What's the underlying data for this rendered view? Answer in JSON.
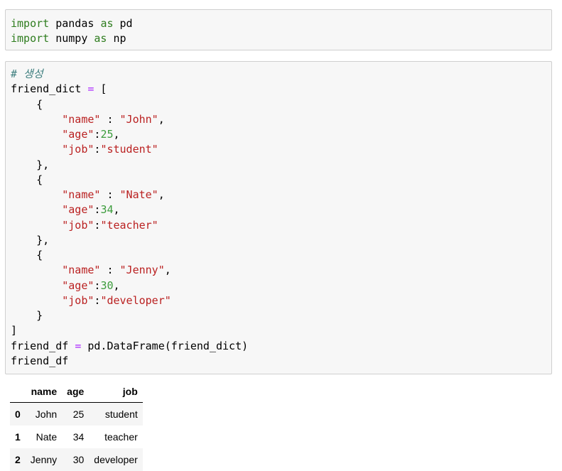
{
  "cells": [
    {
      "lines": [
        [
          [
            "kw",
            "import"
          ],
          [
            "t",
            " pandas "
          ],
          [
            "kw",
            "as"
          ],
          [
            "t",
            " pd"
          ]
        ],
        [
          [
            "kw",
            "import"
          ],
          [
            "t",
            " numpy "
          ],
          [
            "kw",
            "as"
          ],
          [
            "t",
            " np"
          ]
        ]
      ]
    },
    {
      "lines": [
        [
          [
            "cmt",
            "# 생성"
          ]
        ],
        [
          [
            "t",
            "friend_dict "
          ],
          [
            "op",
            "="
          ],
          [
            "t",
            " ["
          ]
        ],
        [
          [
            "t",
            "    {"
          ]
        ],
        [
          [
            "t",
            "        "
          ],
          [
            "str",
            "\"name\""
          ],
          [
            "t",
            " : "
          ],
          [
            "str",
            "\"John\""
          ],
          [
            "t",
            ","
          ]
        ],
        [
          [
            "t",
            "        "
          ],
          [
            "str",
            "\"age\""
          ],
          [
            "t",
            ":"
          ],
          [
            "num",
            "25"
          ],
          [
            "t",
            ","
          ]
        ],
        [
          [
            "t",
            "        "
          ],
          [
            "str",
            "\"job\""
          ],
          [
            "t",
            ":"
          ],
          [
            "str",
            "\"student\""
          ]
        ],
        [
          [
            "t",
            "    },"
          ]
        ],
        [
          [
            "t",
            "    {"
          ]
        ],
        [
          [
            "t",
            "        "
          ],
          [
            "str",
            "\"name\""
          ],
          [
            "t",
            " : "
          ],
          [
            "str",
            "\"Nate\""
          ],
          [
            "t",
            ","
          ]
        ],
        [
          [
            "t",
            "        "
          ],
          [
            "str",
            "\"age\""
          ],
          [
            "t",
            ":"
          ],
          [
            "num",
            "34"
          ],
          [
            "t",
            ","
          ]
        ],
        [
          [
            "t",
            "        "
          ],
          [
            "str",
            "\"job\""
          ],
          [
            "t",
            ":"
          ],
          [
            "str",
            "\"teacher\""
          ]
        ],
        [
          [
            "t",
            "    },"
          ]
        ],
        [
          [
            "t",
            "    {"
          ]
        ],
        [
          [
            "t",
            "        "
          ],
          [
            "str",
            "\"name\""
          ],
          [
            "t",
            " : "
          ],
          [
            "str",
            "\"Jenny\""
          ],
          [
            "t",
            ","
          ]
        ],
        [
          [
            "t",
            "        "
          ],
          [
            "str",
            "\"age\""
          ],
          [
            "t",
            ":"
          ],
          [
            "num",
            "30"
          ],
          [
            "t",
            ","
          ]
        ],
        [
          [
            "t",
            "        "
          ],
          [
            "str",
            "\"job\""
          ],
          [
            "t",
            ":"
          ],
          [
            "str",
            "\"developer\""
          ]
        ],
        [
          [
            "t",
            "    }"
          ]
        ],
        [
          [
            "t",
            "]"
          ]
        ],
        [
          [
            "t",
            "friend_df "
          ],
          [
            "op",
            "="
          ],
          [
            "t",
            " pd.DataFrame(friend_dict)"
          ]
        ],
        [
          [
            "t",
            "friend_df"
          ]
        ]
      ]
    }
  ],
  "dataframe": {
    "columns": [
      "name",
      "age",
      "job"
    ],
    "rows": [
      {
        "index": "0",
        "name": "John",
        "age": "25",
        "job": "student"
      },
      {
        "index": "1",
        "name": "Nate",
        "age": "34",
        "job": "teacher"
      },
      {
        "index": "2",
        "name": "Jenny",
        "age": "30",
        "job": "developer"
      }
    ]
  }
}
